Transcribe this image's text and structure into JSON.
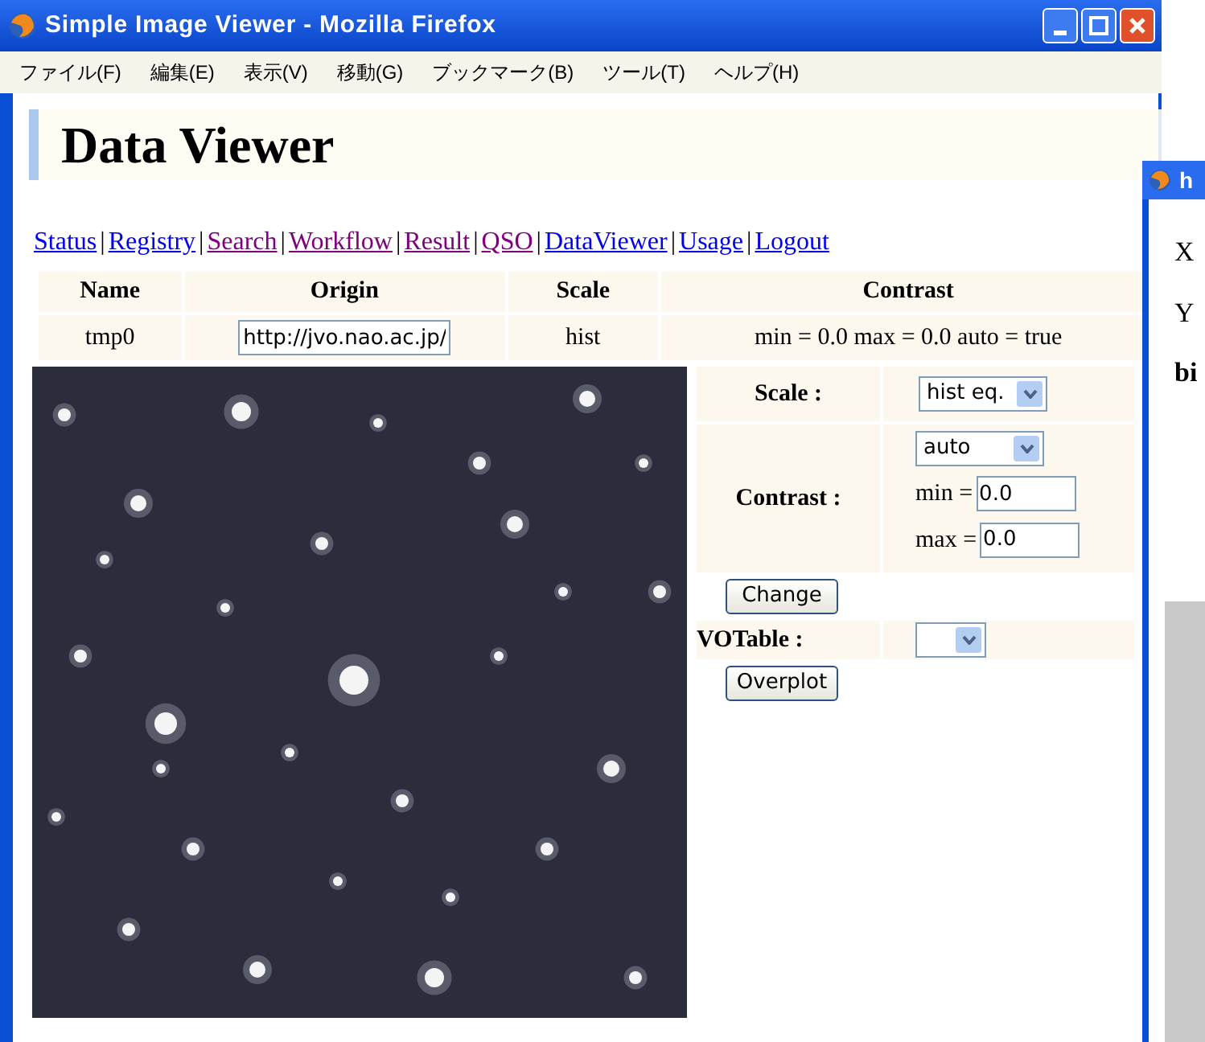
{
  "window": {
    "title": "Simple Image Viewer - Mozilla Firefox"
  },
  "menu": [
    "ファイル(F)",
    "編集(E)",
    "表示(V)",
    "移動(G)",
    "ブックマーク(B)",
    "ツール(T)",
    "ヘルプ(H)"
  ],
  "page_title": "Data Viewer",
  "nav": [
    {
      "kind": "link",
      "label": "Status",
      "visited": false
    },
    {
      "kind": "separator",
      "label": "|"
    },
    {
      "kind": "link",
      "label": "Registry",
      "visited": false
    },
    {
      "kind": "separator",
      "label": "|"
    },
    {
      "kind": "link",
      "label": "Search",
      "visited": true
    },
    {
      "kind": "separator",
      "label": "|"
    },
    {
      "kind": "link",
      "label": "Workflow",
      "visited": true
    },
    {
      "kind": "separator",
      "label": "|"
    },
    {
      "kind": "link",
      "label": "Result",
      "visited": true
    },
    {
      "kind": "separator",
      "label": "|"
    },
    {
      "kind": "link",
      "label": "QSO",
      "visited": true
    },
    {
      "kind": "separator",
      "label": "|"
    },
    {
      "kind": "link",
      "label": "DataViewer",
      "visited": false
    },
    {
      "kind": "separator",
      "label": "|"
    },
    {
      "kind": "link",
      "label": "Usage",
      "visited": false
    },
    {
      "kind": "separator",
      "label": "|"
    },
    {
      "kind": "link",
      "label": "Logout",
      "visited": false
    }
  ],
  "table": {
    "columns": [
      "Name",
      "Origin",
      "Scale",
      "Contrast"
    ],
    "rows": [
      {
        "name": "tmp0",
        "origin": "http://jvo.nao.ac.jp/",
        "scale": "hist",
        "contrast": "min = 0.0 max = 0.0 auto = true"
      }
    ]
  },
  "controls": {
    "scale_label": "Scale :",
    "scale_value": "hist eq.",
    "contrast_label": "Contrast :",
    "contrast_mode": "auto",
    "min_label": "min =",
    "min_value": "0.0",
    "max_label": "max =",
    "max_value": "0.0",
    "change_button": "Change",
    "votable_label": "VOTable :",
    "overplot_button": "Overplot"
  },
  "second_window": {
    "title": "h",
    "labels": [
      "X",
      "Y",
      "bi"
    ]
  }
}
